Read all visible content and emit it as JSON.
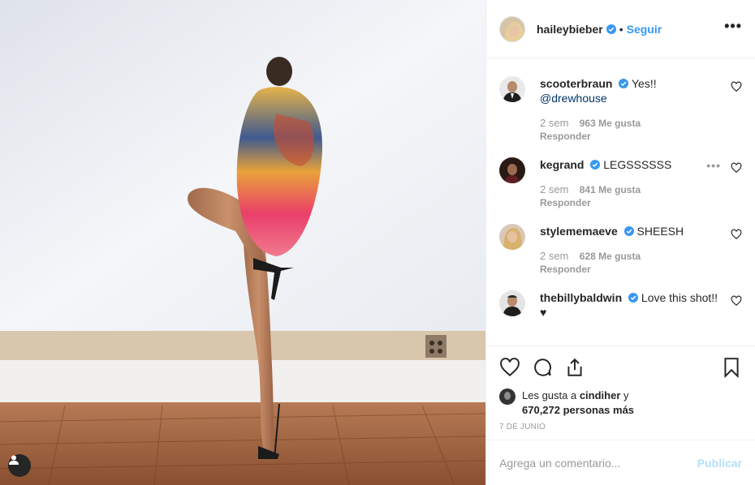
{
  "post": {
    "photo": {
      "alt_icon": "user-tag-icon"
    },
    "author": {
      "username": "haileybieber",
      "verified": true,
      "separator": "•",
      "follow_label": "Seguir",
      "more_label": "•••"
    },
    "comments": [
      {
        "username": "scooterbraun",
        "verified": true,
        "text": "Yes!!",
        "mention": "@drewhouse",
        "time": "2 sem",
        "likes": "963 Me gusta",
        "reply_label": "Responder"
      },
      {
        "username": "kegrand",
        "verified": true,
        "text": "LEGSSSSSS",
        "time": "2 sem",
        "likes": "841 Me gusta",
        "reply_label": "Responder",
        "more_label": "•••"
      },
      {
        "username": "stylememaeve",
        "verified": true,
        "text": "SHEESH",
        "time": "2 sem",
        "likes": "628 Me gusta",
        "reply_label": "Responder"
      },
      {
        "username": "thebillybaldwin",
        "verified": true,
        "text": "Love this shot!!",
        "text2": "♥"
      }
    ],
    "likes_line": {
      "prefix": "Les gusta a ",
      "user": "cindiher",
      "middle": " y",
      "count": "670,272 personas más"
    },
    "date": "7 DE JUNIO",
    "add_comment": {
      "placeholder": "Agrega un comentario...",
      "publish_label": "Publicar"
    },
    "colors": {
      "accent": "#3897f0",
      "verified": "#3897f0",
      "muted": "#999999",
      "publish_disabled": "#b2dffc"
    }
  }
}
